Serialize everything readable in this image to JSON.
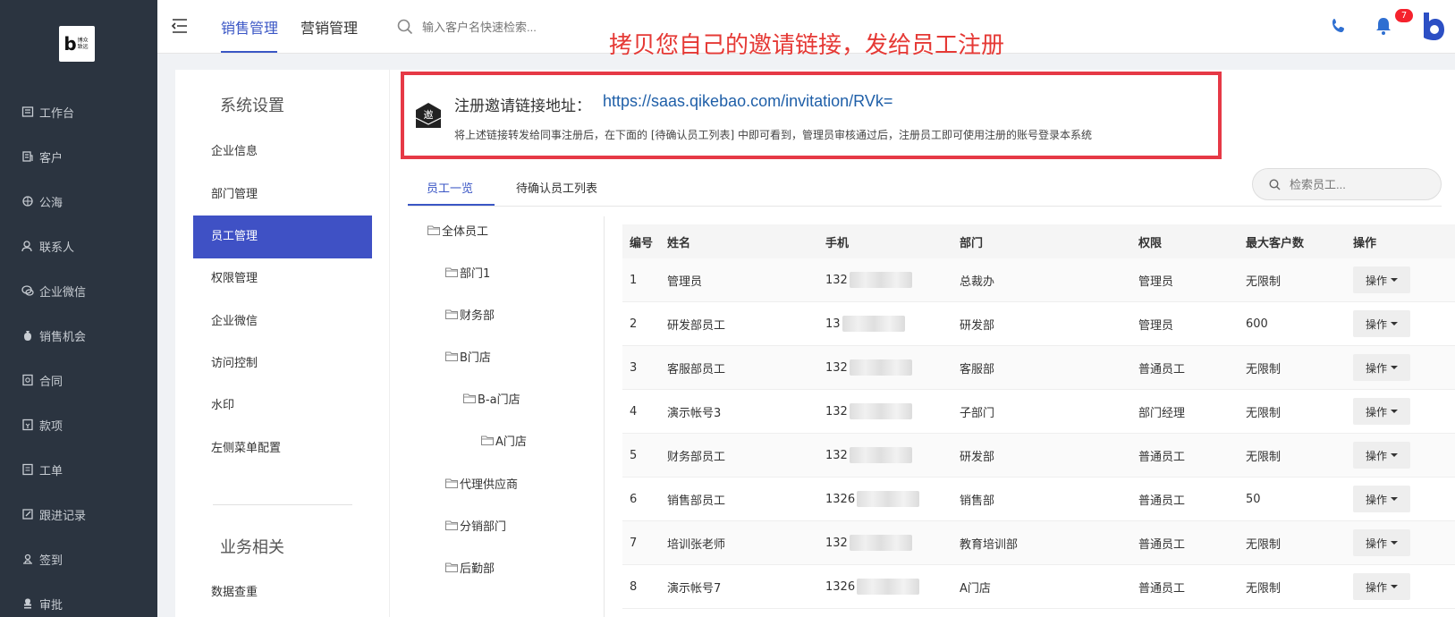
{
  "logo": {
    "letter": "b",
    "text": "博众\n致远"
  },
  "sidebar": {
    "items": [
      {
        "label": "工作台",
        "icon": "dashboard-icon"
      },
      {
        "label": "客户",
        "icon": "customer-icon"
      },
      {
        "label": "公海",
        "icon": "public-pool-icon"
      },
      {
        "label": "联系人",
        "icon": "contact-icon"
      },
      {
        "label": "企业微信",
        "icon": "wechat-icon"
      },
      {
        "label": "销售机会",
        "icon": "money-bag-icon"
      },
      {
        "label": "合同",
        "icon": "contract-icon"
      },
      {
        "label": "款项",
        "icon": "payment-icon"
      },
      {
        "label": "工单",
        "icon": "ticket-icon"
      },
      {
        "label": "跟进记录",
        "icon": "followup-icon"
      },
      {
        "label": "签到",
        "icon": "checkin-icon"
      },
      {
        "label": "审批",
        "icon": "approval-icon"
      }
    ]
  },
  "topbar": {
    "tabs": [
      "销售管理",
      "营销管理"
    ],
    "search_placeholder": "输入客户名快速检索...",
    "notification_count": "7"
  },
  "settings": {
    "section1_title": "系统设置",
    "items": [
      "企业信息",
      "部门管理",
      "员工管理",
      "权限管理",
      "企业微信",
      "访问控制",
      "水印",
      "左侧菜单配置"
    ],
    "section2_title": "业务相关",
    "items2": [
      "数据查重"
    ]
  },
  "annotation": "拷贝您自己的邀请链接，发给员工注册",
  "invite": {
    "icon_char": "邀",
    "label": "注册邀请链接地址：",
    "link": "https://saas.qikebao.com/invitation/RVk=",
    "desc": "将上述链接转发给同事注册后，在下面的 [待确认员工列表] 中即可看到，管理员审核通过后，注册员工即可使用注册的账号登录本系统"
  },
  "tabs": [
    "员工一览",
    "待确认员工列表"
  ],
  "emp_search_placeholder": "检索员工...",
  "tree": [
    "全体员工",
    "部门1",
    "财务部",
    "B门店",
    "B-a门店",
    "A门店",
    "代理供应商",
    "分销部门",
    "后勤部"
  ],
  "table": {
    "headers": [
      "编号",
      "姓名",
      "手机",
      "部门",
      "权限",
      "最大客户数",
      "操作"
    ],
    "rows": [
      {
        "no": "1",
        "name": "管理员",
        "phone": "132",
        "dept": "总裁办",
        "role": "管理员",
        "max": "无限制",
        "op": "操作"
      },
      {
        "no": "2",
        "name": "研发部员工",
        "phone": "13",
        "dept": "研发部",
        "role": "管理员",
        "max": "600",
        "op": "操作"
      },
      {
        "no": "3",
        "name": "客服部员工",
        "phone": "132",
        "dept": "客服部",
        "role": "普通员工",
        "max": "无限制",
        "op": "操作"
      },
      {
        "no": "4",
        "name": "演示帐号3",
        "phone": "132",
        "dept": "子部门",
        "role": "部门经理",
        "max": "无限制",
        "op": "操作"
      },
      {
        "no": "5",
        "name": "财务部员工",
        "phone": "132",
        "dept": "研发部",
        "role": "普通员工",
        "max": "无限制",
        "op": "操作"
      },
      {
        "no": "6",
        "name": "销售部员工",
        "phone": "1326",
        "dept": "销售部",
        "role": "普通员工",
        "max": "50",
        "op": "操作"
      },
      {
        "no": "7",
        "name": "培训张老师",
        "phone": "132",
        "dept": "教育培训部",
        "role": "普通员工",
        "max": "无限制",
        "op": "操作"
      },
      {
        "no": "8",
        "name": "演示帐号7",
        "phone": "1326",
        "dept": "A门店",
        "role": "普通员工",
        "max": "无限制",
        "op": "操作"
      }
    ]
  },
  "colors": {
    "sidebar_bg": "#2b3440",
    "accent": "#3a56c5",
    "annotation": "#e53935",
    "link": "#1f5fa8"
  }
}
